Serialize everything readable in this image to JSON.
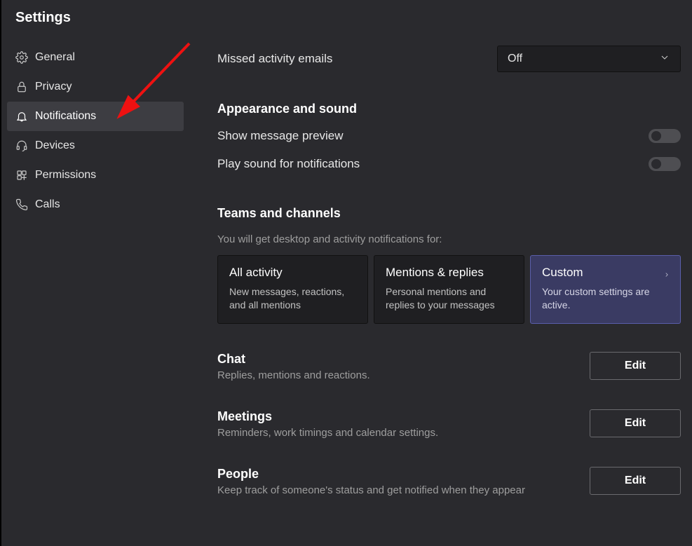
{
  "title": "Settings",
  "sidebar": {
    "items": [
      {
        "label": "General",
        "icon": "gear"
      },
      {
        "label": "Privacy",
        "icon": "lock"
      },
      {
        "label": "Notifications",
        "icon": "bell",
        "active": true
      },
      {
        "label": "Devices",
        "icon": "headset"
      },
      {
        "label": "Permissions",
        "icon": "grid"
      },
      {
        "label": "Calls",
        "icon": "phone"
      }
    ]
  },
  "missedActivity": {
    "label": "Missed activity emails",
    "value": "Off"
  },
  "appearance": {
    "heading": "Appearance and sound",
    "preview": {
      "label": "Show message preview",
      "value": false
    },
    "sound": {
      "label": "Play sound for notifications",
      "value": false
    }
  },
  "teamsChannels": {
    "heading": "Teams and channels",
    "sub": "You will get desktop and activity notifications for:",
    "options": [
      {
        "title": "All activity",
        "desc": "New messages, reactions, and all mentions"
      },
      {
        "title": "Mentions & replies",
        "desc": "Personal mentions and replies to your messages"
      },
      {
        "title": "Custom",
        "desc": "Your custom settings are active.",
        "selected": true
      }
    ]
  },
  "chat": {
    "title": "Chat",
    "sub": "Replies, mentions and reactions.",
    "button": "Edit"
  },
  "meetings": {
    "title": "Meetings",
    "sub": "Reminders, work timings and calendar settings.",
    "button": "Edit"
  },
  "people": {
    "title": "People",
    "sub": "Keep track of someone's status and get notified when they appear",
    "button": "Edit"
  }
}
